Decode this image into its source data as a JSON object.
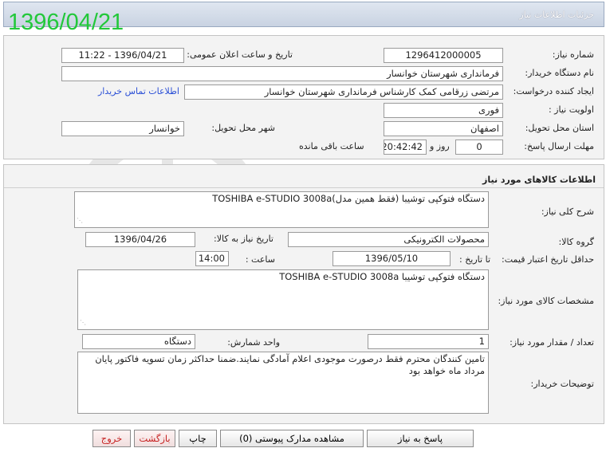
{
  "stamp_date": "1396/04/21",
  "window_title": "جزئیات اطلاعات نیاز",
  "general": {
    "need_number_label": "شماره نیاز:",
    "need_number": "1296412000005",
    "announce_label": "تاریخ و ساعت اعلان عمومی:",
    "announce_value": "1396/04/21 - 11:22",
    "buyer_label": "نام دستگاه خریدار:",
    "buyer_value": "فرمانداری شهرستان خوانسار",
    "creator_label": "ایجاد کننده درخواست:",
    "creator_value": "مرتضی زرقامی کمک کارشناس فرمانداری شهرستان خوانسار",
    "contact_link": "اطلاعات تماس خریدار",
    "priority_label": "اولویت نیاز :",
    "priority_value": "فوری",
    "province_label": "استان محل تحویل:",
    "province_value": "اصفهان",
    "city_label": "شهر محل تحویل:",
    "city_value": "خوانسار",
    "deadline_label": "مهلت ارسال پاسخ:",
    "days_value": "0",
    "days_label": "روز و",
    "time_value": "20:42:42",
    "remaining_label": "ساعت باقی مانده"
  },
  "goods": {
    "section_title": "اطلاعات کالاهای مورد نیاز",
    "summary_label": "شرح کلی نیاز:",
    "summary_value": "دستگاه فتوکپی توشیبا  (فقط همین مدل)TOSHIBA e-STUDIO 3008a",
    "group_label": "گروه کالا:",
    "group_value": "محصولات الکترونیکی",
    "need_date_label": "تاریخ نیاز به کالا:",
    "need_date_value": "1396/04/26",
    "validity_label": "حداقل تاریخ اعتبار قیمت:",
    "until_date_label": "تا تاریخ :",
    "until_date_value": "1396/05/10",
    "time_label": "ساعت :",
    "time_value": "14:00",
    "spec_label": "مشخصات کالای مورد نیاز:",
    "spec_value": "دستگاه فتوکپی توشیبا  TOSHIBA e-STUDIO 3008a",
    "qty_label": "تعداد / مقدار مورد نیاز:",
    "qty_value": "1",
    "unit_label": "واحد شمارش:",
    "unit_value": "دستگاه",
    "notes_label": "توضیحات خریدار:",
    "notes_value": "تامین کنندگان محترم فقط درصورت  موجودی اعلام آمادگی نمایند.ضمنا حداکثر زمان تسویه فاکتور پایان مرداد ماه خواهد بود"
  },
  "buttons": {
    "reply": "پاسخ به نیاز",
    "attachments": "مشاهده مدارک پیوستی (0)",
    "print": "چاپ",
    "back": "بازگشت",
    "exit": "خروج"
  }
}
